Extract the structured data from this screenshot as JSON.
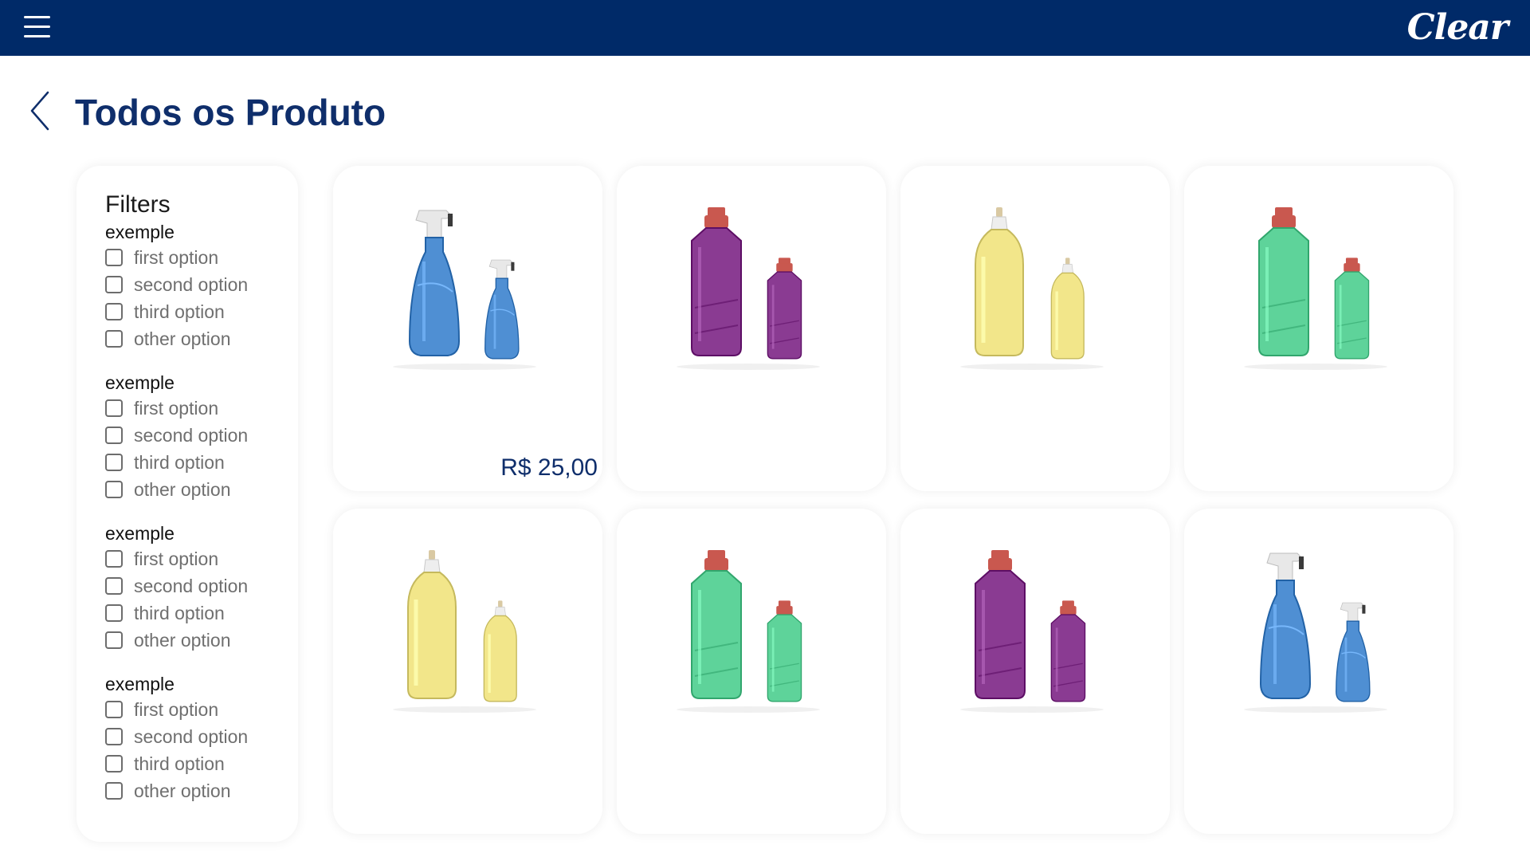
{
  "header": {
    "brand": "Clear",
    "menu_icon": "hamburger-menu-icon"
  },
  "page": {
    "title": "Todos os Produto",
    "back_icon": "chevron-left-icon"
  },
  "filters": {
    "title": "Filters",
    "groups": [
      {
        "label": "exemple",
        "options": [
          "first option",
          "second option",
          "third option",
          "other option"
        ]
      },
      {
        "label": "exemple",
        "options": [
          "first option",
          "second option",
          "third option",
          "other option"
        ]
      },
      {
        "label": "exemple",
        "options": [
          "first option",
          "second option",
          "third option",
          "other option"
        ]
      },
      {
        "label": "exemple",
        "options": [
          "first option",
          "second option",
          "third option",
          "other option"
        ]
      }
    ]
  },
  "products": [
    {
      "kind": "spray",
      "color": "#4f8fd3",
      "price": "R$ 25,00"
    },
    {
      "kind": "jug",
      "color": "#8a3b92"
    },
    {
      "kind": "dish",
      "color": "#f2e68a"
    },
    {
      "kind": "jug",
      "color": "#5ed39a"
    },
    {
      "kind": "dish",
      "color": "#f2e68a"
    },
    {
      "kind": "jug",
      "color": "#5ed39a"
    },
    {
      "kind": "jug",
      "color": "#8a3b92"
    },
    {
      "kind": "spray",
      "color": "#4f8fd3"
    }
  ],
  "colors": {
    "header_bg": "#002a68",
    "accent_text": "#0f2e6b",
    "cap_red": "#c9584f",
    "nozzle": "#e8e8e8"
  }
}
